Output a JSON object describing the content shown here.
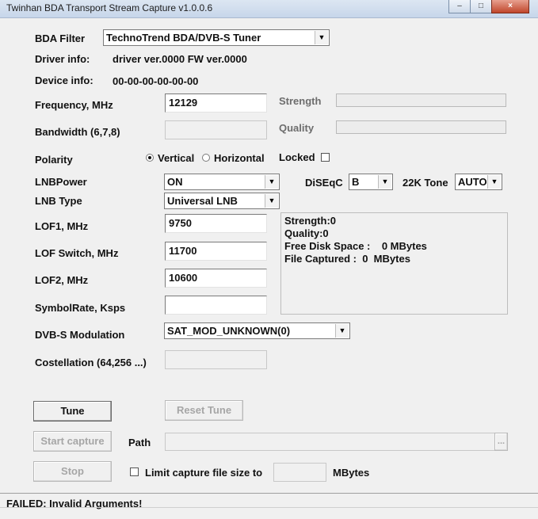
{
  "window": {
    "title": "Twinhan BDA Transport Stream Capture v1.0.0.6",
    "minimize": "‒",
    "maximize": "□",
    "close": "×"
  },
  "bda_filter": {
    "label": "BDA Filter",
    "value": "TechnoTrend BDA/DVB-S Tuner"
  },
  "driver_info": {
    "label": "Driver info:",
    "value": "driver ver.0000 FW ver.0000"
  },
  "device_info": {
    "label": "Device info:",
    "value": "00-00-00-00-00-00"
  },
  "frequency": {
    "label": "Frequency, MHz",
    "value": "12129"
  },
  "bandwidth": {
    "label": "Bandwidth (6,7,8)",
    "value": ""
  },
  "strength": {
    "label": "Strength"
  },
  "quality": {
    "label": "Quality"
  },
  "polarity": {
    "label": "Polarity",
    "vertical": "Vertical",
    "horizontal": "Horizontal",
    "selected": "Vertical"
  },
  "locked": {
    "label": "Locked"
  },
  "lnb_power": {
    "label": "LNBPower",
    "value": "ON"
  },
  "diseqc": {
    "label": "DiSEqC",
    "value": "B"
  },
  "tone22k": {
    "label": "22K Tone",
    "value": "AUTO"
  },
  "lnb_type": {
    "label": "LNB Type",
    "value": "Universal LNB"
  },
  "lof1": {
    "label": "LOF1, MHz",
    "value": "9750"
  },
  "lof_switch": {
    "label": "LOF Switch, MHz",
    "value": "11700"
  },
  "lof2": {
    "label": "LOF2, MHz",
    "value": "10600"
  },
  "symbol_rate": {
    "label": "SymbolRate, Ksps",
    "value": ""
  },
  "modulation": {
    "label": "DVB-S Modulation",
    "value": "SAT_MOD_UNKNOWN(0)"
  },
  "constellation": {
    "label": "Costellation (64,256 ...)",
    "value": ""
  },
  "info": {
    "strength": "Strength:0",
    "quality": "Quality:0",
    "free_disk": "Free Disk Space :    0 MBytes",
    "file_captured": "File Captured :  0  MBytes"
  },
  "buttons": {
    "tune": "Tune",
    "reset_tune": "Reset Tune",
    "start_capture": "Start capture",
    "stop": "Stop",
    "browse": "..."
  },
  "path": {
    "label": "Path",
    "value": ""
  },
  "limit": {
    "label": "Limit capture file size to",
    "value": "",
    "unit": "MBytes"
  },
  "status": {
    "text": "FAILED: Invalid Arguments!"
  }
}
